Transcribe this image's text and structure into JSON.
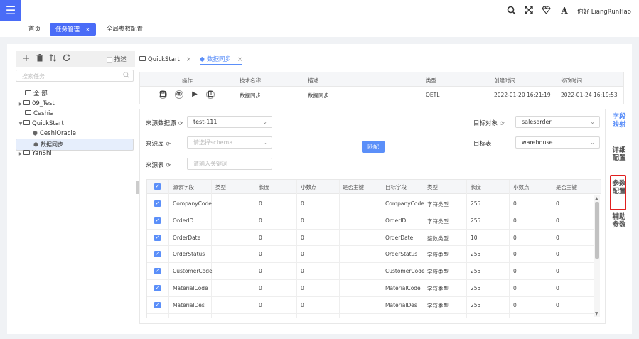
{
  "header": {
    "greeting": "你好 LiangRunHao",
    "icons": [
      "search-icon",
      "fullscreen-icon",
      "diamond-icon",
      "font-icon"
    ],
    "font_glyph": "A"
  },
  "nav": {
    "tabs": [
      {
        "label": "首页"
      },
      {
        "label": "任务管理"
      },
      {
        "label": "全局参数配置"
      }
    ],
    "close": "×"
  },
  "sidebar": {
    "desc_label": "描述",
    "search_placeholder": "搜索任务",
    "tree": [
      {
        "label": "全 部"
      },
      {
        "label": "09_Test"
      },
      {
        "label": "Ceshia"
      },
      {
        "label": "QuickStart"
      },
      {
        "label": "CeshiOracle"
      },
      {
        "label": "数据同步"
      },
      {
        "label": "YanShi"
      }
    ]
  },
  "tabs": [
    {
      "label": "QuickStart"
    },
    {
      "label": "数据同步"
    }
  ],
  "task_table": {
    "headers": [
      "操作",
      "技术名称",
      "描述",
      "类型",
      "创建时间",
      "修改时间"
    ],
    "row": {
      "tech_name": "数据同步",
      "desc": "数据同步",
      "type": "QETL",
      "created": "2022-01-20 16:21:19",
      "modified": "2022-01-24 16:19:53"
    }
  },
  "form": {
    "source_ds_label": "来源数据源",
    "source_ds_value": "test-111",
    "source_db_label": "来源库",
    "source_db_placeholder": "请选择schema",
    "source_table_label": "来源表",
    "source_table_placeholder": "请输入关键词",
    "target_obj_label": "目标对象",
    "target_obj_value": "salesorder",
    "target_table_label": "目标表",
    "target_table_value": "warehouse",
    "match_button": "匹配"
  },
  "field_table": {
    "headers": [
      "源表字段",
      "类型",
      "长度",
      "小数点",
      "是否主键",
      "目标字段",
      "类型",
      "长度",
      "小数点",
      "是否主键"
    ],
    "rows": [
      {
        "src": "CompanyCode",
        "len": "0",
        "dec": "0",
        "tgt": "CompanyCode",
        "ttype": "字符类型",
        "tlen": "255",
        "tdec": "0",
        "tpk": "0"
      },
      {
        "src": "OrderID",
        "len": "0",
        "dec": "0",
        "tgt": "OrderID",
        "ttype": "字符类型",
        "tlen": "255",
        "tdec": "0",
        "tpk": "0"
      },
      {
        "src": "OrderDate",
        "len": "0",
        "dec": "0",
        "tgt": "OrderDate",
        "ttype": "整数类型",
        "tlen": "10",
        "tdec": "0",
        "tpk": "0"
      },
      {
        "src": "OrderStatus",
        "len": "0",
        "dec": "0",
        "tgt": "OrderStatus",
        "ttype": "字符类型",
        "tlen": "255",
        "tdec": "0",
        "tpk": "0"
      },
      {
        "src": "CustomerCode",
        "len": "0",
        "dec": "0",
        "tgt": "CustomerCode",
        "ttype": "字符类型",
        "tlen": "255",
        "tdec": "0",
        "tpk": "0"
      },
      {
        "src": "MaterialCode",
        "len": "0",
        "dec": "0",
        "tgt": "MaterialCode",
        "ttype": "字符类型",
        "tlen": "255",
        "tdec": "0",
        "tpk": "0"
      },
      {
        "src": "MaterialDes",
        "len": "0",
        "dec": "0",
        "tgt": "MaterialDes",
        "ttype": "字符类型",
        "tlen": "255",
        "tdec": "0",
        "tpk": "0"
      }
    ]
  },
  "side_tabs": [
    {
      "label": "字段映射"
    },
    {
      "label": "详细配置"
    },
    {
      "label": "参数配置"
    },
    {
      "label": "辅助参数"
    }
  ],
  "colors": {
    "accent": "#4a6cf7",
    "link": "#5b8ff9",
    "highlight": "#e02020"
  }
}
